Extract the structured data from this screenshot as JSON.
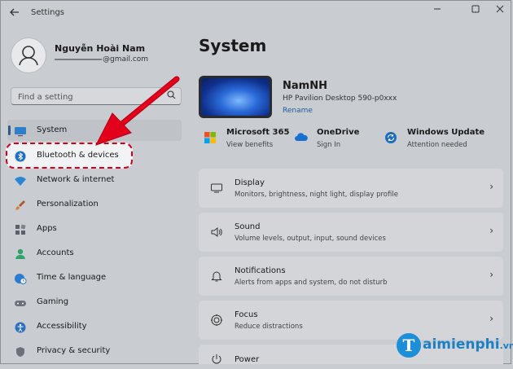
{
  "window": {
    "title": "Settings"
  },
  "user": {
    "name": "Nguyễn Hoài Nam",
    "email_suffix": "@gmail.com"
  },
  "search": {
    "placeholder": "Find a setting"
  },
  "sidebar": {
    "items": [
      {
        "label": "System",
        "icon": "monitor-icon",
        "selected": true
      },
      {
        "label": "Bluetooth & devices",
        "icon": "bluetooth-icon",
        "highlighted": true
      },
      {
        "label": "Network & internet",
        "icon": "wifi-icon"
      },
      {
        "label": "Personalization",
        "icon": "paintbrush-icon"
      },
      {
        "label": "Apps",
        "icon": "apps-icon"
      },
      {
        "label": "Accounts",
        "icon": "person-icon"
      },
      {
        "label": "Time & language",
        "icon": "globe-clock-icon"
      },
      {
        "label": "Gaming",
        "icon": "gamepad-icon"
      },
      {
        "label": "Accessibility",
        "icon": "accessibility-icon"
      },
      {
        "label": "Privacy & security",
        "icon": "shield-icon"
      }
    ]
  },
  "main": {
    "title": "System",
    "device": {
      "name": "NamNH",
      "model": "HP Pavilion Desktop 590-p0xxx",
      "rename": "Rename"
    },
    "quick": [
      {
        "title": "Microsoft 365",
        "sub": "View benefits",
        "icon": "microsoft-icon"
      },
      {
        "title": "OneDrive",
        "sub": "Sign In",
        "icon": "cloud-icon"
      },
      {
        "title": "Windows Update",
        "sub": "Attention needed",
        "icon": "update-icon"
      }
    ],
    "cards": [
      {
        "title": "Display",
        "sub": "Monitors, brightness, night light, display profile",
        "icon": "display-icon"
      },
      {
        "title": "Sound",
        "sub": "Volume levels, output, input, sound devices",
        "icon": "speaker-icon"
      },
      {
        "title": "Notifications",
        "sub": "Alerts from apps and system, do not disturb",
        "icon": "bell-icon"
      },
      {
        "title": "Focus",
        "sub": "Reduce distractions",
        "icon": "focus-icon"
      },
      {
        "title": "Power",
        "sub": "",
        "icon": "power-icon"
      }
    ]
  },
  "watermark": {
    "text": "aimienphi",
    "suffix": ".vn",
    "logo_letter": "T"
  },
  "colors": {
    "highlight_border": "#d6001c",
    "arrow": "#e3001b",
    "accent": "#2b5b8e",
    "link": "#1f5c99"
  }
}
